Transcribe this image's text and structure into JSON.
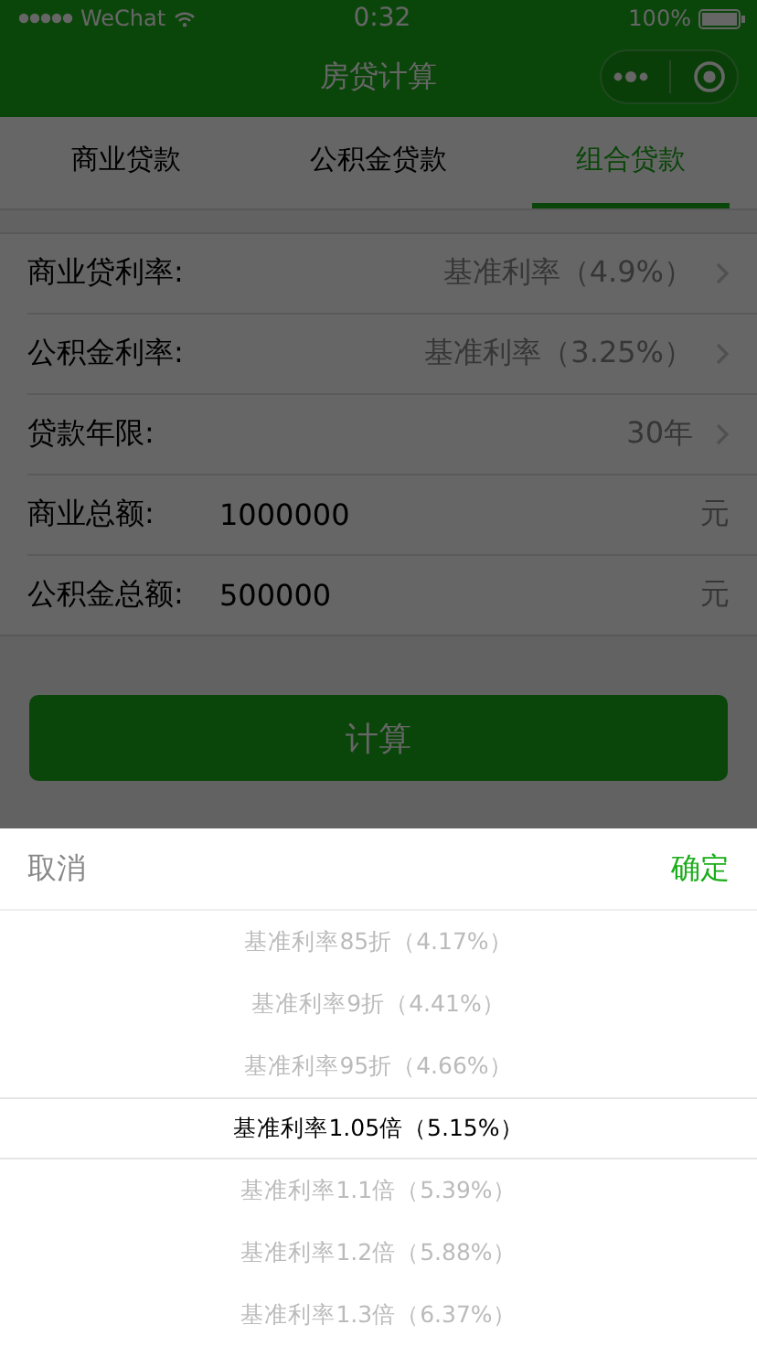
{
  "status_bar": {
    "carrier": "WeChat",
    "time": "0:32",
    "battery": "100%"
  },
  "nav": {
    "title": "房贷计算"
  },
  "tabs": [
    {
      "label": "商业贷款",
      "selected": false
    },
    {
      "label": "公积金贷款",
      "selected": false
    },
    {
      "label": "组合贷款",
      "selected": true
    }
  ],
  "form": [
    {
      "kind": "select",
      "label": "商业贷利率:",
      "value": "基准利率（4.9%）"
    },
    {
      "kind": "select",
      "label": "公积金利率:",
      "value": "基准利率（3.25%）"
    },
    {
      "kind": "select",
      "label": "贷款年限:",
      "value": "30年"
    },
    {
      "kind": "input",
      "label": "商业总额:",
      "value": "1000000",
      "unit": "元"
    },
    {
      "kind": "input",
      "label": "公积金总额:",
      "value": "500000",
      "unit": "元"
    }
  ],
  "calculate_button": "计算",
  "picker": {
    "cancel": "取消",
    "confirm": "确定",
    "options": [
      {
        "label": "基准利率85折（4.17%）",
        "selected": false
      },
      {
        "label": "基准利率9折（4.41%）",
        "selected": false
      },
      {
        "label": "基准利率95折（4.66%）",
        "selected": false
      },
      {
        "label": "基准利率1.05倍（5.15%）",
        "selected": true
      },
      {
        "label": "基准利率1.1倍（5.39%）",
        "selected": false
      },
      {
        "label": "基准利率1.2倍（5.88%）",
        "selected": false
      },
      {
        "label": "基准利率1.3倍（6.37%）",
        "selected": false
      }
    ]
  }
}
